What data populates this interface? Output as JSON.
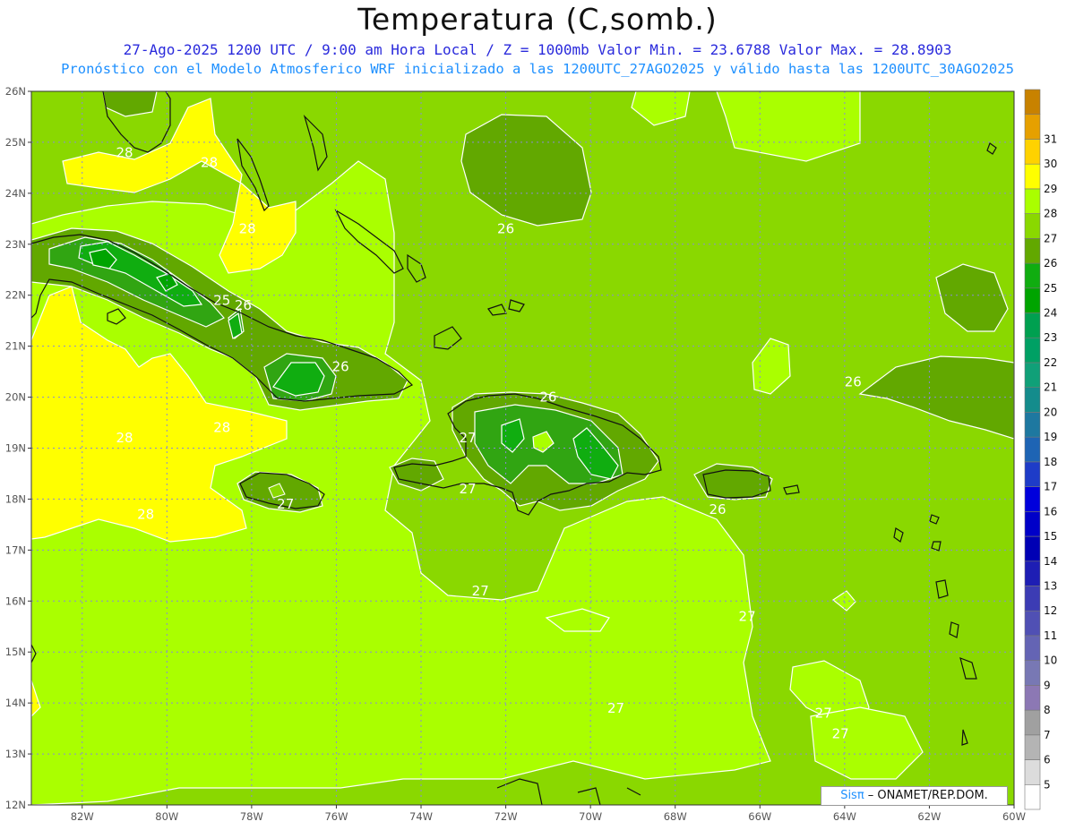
{
  "header": {
    "title": "Temperatura (C,somb.)",
    "line1": "27-Ago-2025  1200 UTC / 9:00 am Hora Local / Z = 1000mb   Valor Min. = 23.6788  Valor Max. = 28.8903",
    "line2": "Pronóstico con el Modelo Atmosferico WRF inicializado a las 1200UTC_27AGO2025 y válido hasta las  1200UTC_30AGO2025"
  },
  "map": {
    "lon_range": [
      -83.2,
      -60
    ],
    "lat_range": [
      12,
      26
    ],
    "lon_ticks": [
      "82W",
      "80W",
      "78W",
      "76W",
      "74W",
      "72W",
      "70W",
      "68W",
      "66W",
      "64W",
      "62W",
      "60W"
    ],
    "lat_ticks": [
      "12N",
      "13N",
      "14N",
      "15N",
      "16N",
      "17N",
      "18N",
      "19N",
      "20N",
      "21N",
      "22N",
      "23N",
      "24N",
      "25N",
      "26N"
    ],
    "contour_labels": [
      {
        "text": "28",
        "lon": -81.0,
        "lat": 24.8
      },
      {
        "text": "28",
        "lon": -79.0,
        "lat": 24.6
      },
      {
        "text": "28",
        "lon": -78.1,
        "lat": 23.3
      },
      {
        "text": "25",
        "lon": -78.7,
        "lat": 21.9
      },
      {
        "text": "26",
        "lon": -78.2,
        "lat": 21.8
      },
      {
        "text": "26",
        "lon": -75.9,
        "lat": 20.6
      },
      {
        "text": "28",
        "lon": -81.0,
        "lat": 19.2
      },
      {
        "text": "28",
        "lon": -78.7,
        "lat": 19.4
      },
      {
        "text": "27",
        "lon": -77.2,
        "lat": 17.9
      },
      {
        "text": "28",
        "lon": -80.5,
        "lat": 17.7
      },
      {
        "text": "26",
        "lon": -72.0,
        "lat": 23.3
      },
      {
        "text": "26",
        "lon": -71.0,
        "lat": 20.0
      },
      {
        "text": "27",
        "lon": -72.9,
        "lat": 19.2
      },
      {
        "text": "27",
        "lon": -72.9,
        "lat": 18.2
      },
      {
        "text": "26",
        "lon": -67.0,
        "lat": 17.8
      },
      {
        "text": "26",
        "lon": -63.8,
        "lat": 20.3
      },
      {
        "text": "27",
        "lon": -72.6,
        "lat": 16.2
      },
      {
        "text": "27",
        "lon": -66.3,
        "lat": 15.7
      },
      {
        "text": "27",
        "lon": -69.4,
        "lat": 13.9
      },
      {
        "text": "27",
        "lon": -64.5,
        "lat": 13.8
      },
      {
        "text": "27",
        "lon": -64.1,
        "lat": 13.4
      }
    ],
    "colors": {
      "t22": "#00a400",
      "t23": "#00b400",
      "t24": "#10ad10",
      "t25": "#31a512",
      "t26": "#62a800",
      "t27": "#8ad800",
      "t28": "#aaff00",
      "t29": "#ffff00"
    }
  },
  "colorbar": {
    "labels": [
      "5",
      "6",
      "7",
      "8",
      "9",
      "10",
      "11",
      "12",
      "13",
      "14",
      "15",
      "16",
      "17",
      "18",
      "19",
      "20",
      "21",
      "22",
      "23",
      "24",
      "25",
      "26",
      "27",
      "28",
      "29",
      "30",
      "31"
    ],
    "colors": [
      "#ffffff",
      "#dcdcdc",
      "#b4b4b4",
      "#a0a0a0",
      "#8c78b4",
      "#7878b4",
      "#6464b4",
      "#5050b4",
      "#3c3cb4",
      "#1e1eb4",
      "#0000b4",
      "#0000c8",
      "#0000dc",
      "#1e3cc8",
      "#1e64b4",
      "#1e78a0",
      "#148c8c",
      "#10a078",
      "#00a064",
      "#00a050",
      "#00a400",
      "#10ad10",
      "#62a800",
      "#8ad800",
      "#aaff00",
      "#ffff00",
      "#ffd200",
      "#e6a000",
      "#c88200"
    ]
  },
  "credit": {
    "brand": "Sisπ",
    "text": " – ONAMET/REP.DOM."
  }
}
